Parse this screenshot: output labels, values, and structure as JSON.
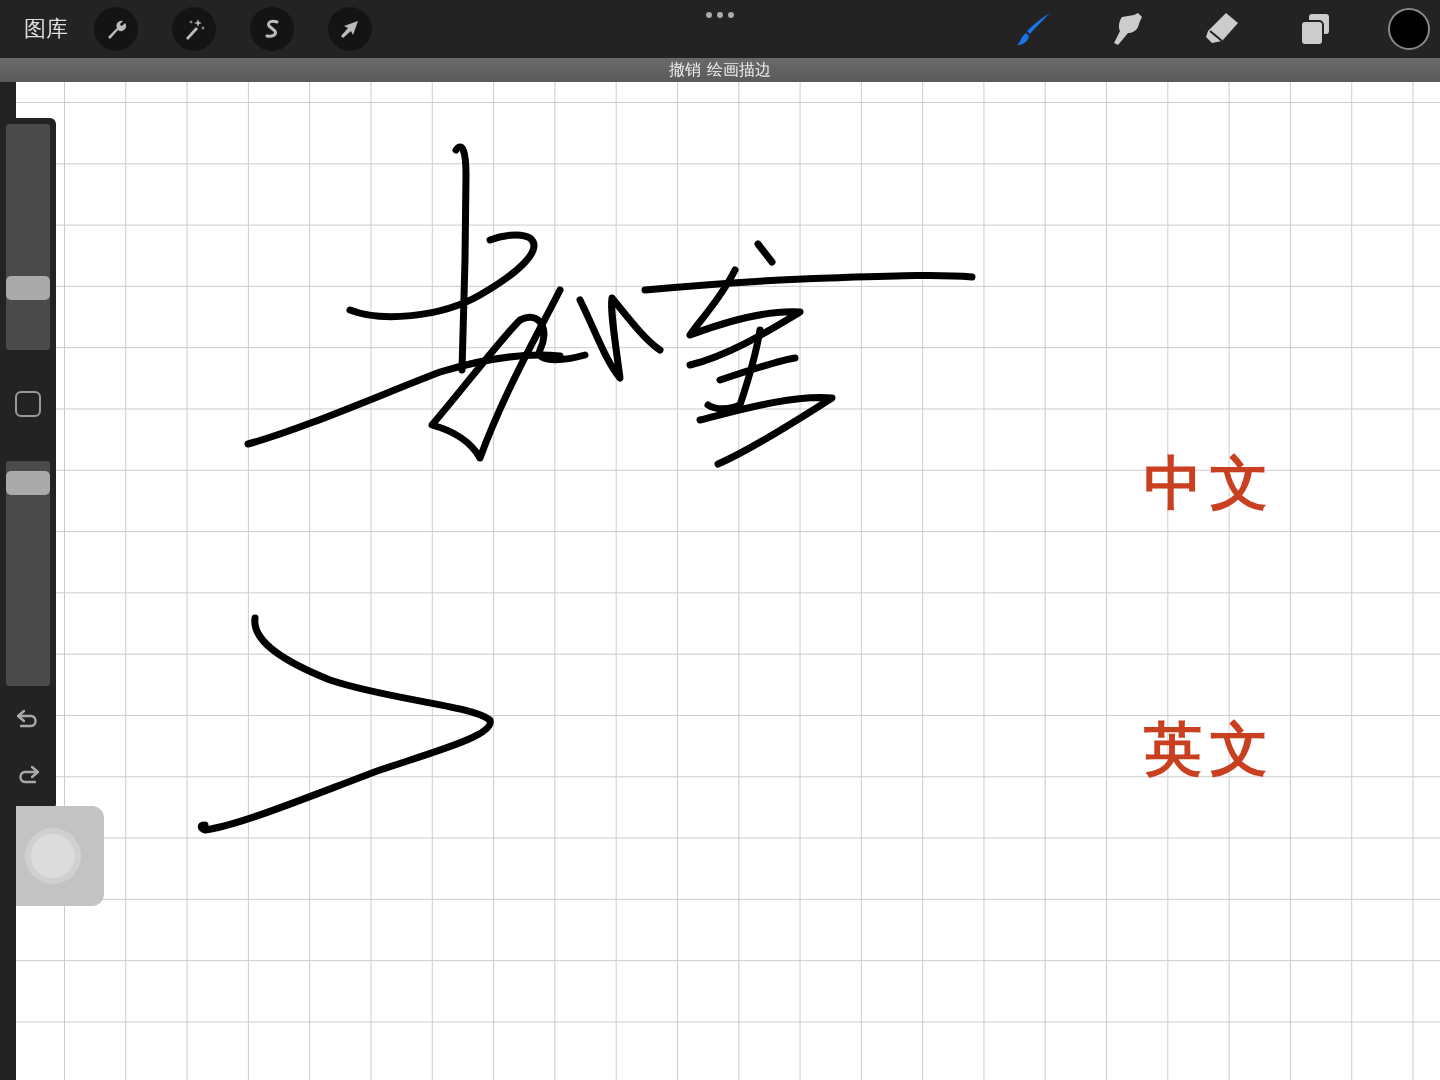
{
  "top_bar": {
    "gallery_label": "图库",
    "left_tools": [
      {
        "kind": "wrench"
      },
      {
        "kind": "wand"
      },
      {
        "kind": "selection"
      },
      {
        "kind": "arrow"
      }
    ],
    "right_tools": [
      {
        "kind": "brush",
        "selected": true
      },
      {
        "kind": "smudge",
        "selected": false
      },
      {
        "kind": "eraser",
        "selected": false
      },
      {
        "kind": "layers",
        "selected": false
      }
    ]
  },
  "undo_banner": {
    "text": "撤销 绘画描边"
  },
  "sidebar": {
    "size_slider": {
      "level": 0.25
    },
    "opacity_slider": {
      "level": 0.95
    }
  },
  "canvas": {
    "labels": [
      {
        "text": "中文"
      },
      {
        "text": "英文"
      }
    ]
  }
}
